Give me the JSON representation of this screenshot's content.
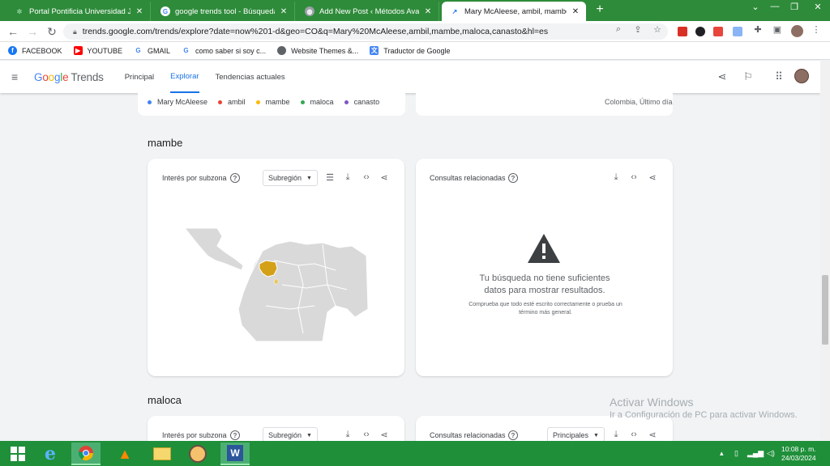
{
  "browser": {
    "tabs": [
      {
        "title": "Portal Pontificia Universidad Jave",
        "favicon": "gear-icon",
        "active": false
      },
      {
        "title": "google trends tool - Búsqueda d",
        "favicon": "google-icon",
        "active": false
      },
      {
        "title": "Add New Post ‹ Métodos Avanza",
        "favicon": "globe-icon",
        "active": false
      },
      {
        "title": "Mary McAleese, ambil, mambe, m",
        "favicon": "trends-icon",
        "active": true
      }
    ],
    "url": "trends.google.com/trends/explore?date=now%201-d&geo=CO&q=Mary%20McAleese,ambil,mambe,maloca,canasto&hl=es"
  },
  "bookmarks": [
    {
      "label": "FACEBOOK",
      "icon": "facebook-icon",
      "color": "#1877f2"
    },
    {
      "label": "YOUTUBE",
      "icon": "youtube-icon",
      "color": "#ff0000"
    },
    {
      "label": "GMAIL",
      "icon": "google-icon",
      "color": "#4285f4"
    },
    {
      "label": "como saber si soy c...",
      "icon": "google-icon",
      "color": "#4285f4"
    },
    {
      "label": "Website Themes &...",
      "icon": "globe-icon",
      "color": "#5f6368"
    },
    {
      "label": "Traductor de Google",
      "icon": "translate-icon",
      "color": "#4285f4"
    }
  ],
  "header": {
    "logo": {
      "google": "Google",
      "trends": "Trends"
    },
    "nav": [
      {
        "label": "Principal",
        "active": false
      },
      {
        "label": "Explorar",
        "active": true
      },
      {
        "label": "Tendencias actuales",
        "active": false
      }
    ]
  },
  "legend": {
    "terms": [
      {
        "label": "Mary McAleese",
        "color": "#4285f4"
      },
      {
        "label": "ambil",
        "color": "#ea4335"
      },
      {
        "label": "mambe",
        "color": "#fbbc04"
      },
      {
        "label": "maloca",
        "color": "#34a853"
      },
      {
        "label": "canasto",
        "color": "#7e57c2"
      }
    ],
    "region": "Colombia, Último día"
  },
  "sections": [
    {
      "title": "mambe",
      "map_card": {
        "title": "Interés por subzona",
        "select": "Subregión"
      },
      "related_card": {
        "title": "Consultas relacionadas",
        "nodata_main": "Tu búsqueda no tiene suficientes datos para mostrar resultados.",
        "nodata_sub": "Comprueba que todo esté escrito correctamente o prueba un término más general."
      }
    },
    {
      "title": "maloca",
      "map_card": {
        "title": "Interés por subzona",
        "select": "Subregión"
      },
      "related_card": {
        "title": "Consultas relacionadas",
        "select": "Principales"
      }
    }
  ],
  "watermark": {
    "line1": "Activar Windows",
    "line2": "Ir a Configuración de PC para activar Windows."
  },
  "taskbar": {
    "time": "10:08 p. m.",
    "date": "24/03/2024"
  },
  "colors": {
    "tabstrip": "#2e8b3a",
    "accent": "#1a73e8",
    "map_highlight": "#d4a017"
  }
}
